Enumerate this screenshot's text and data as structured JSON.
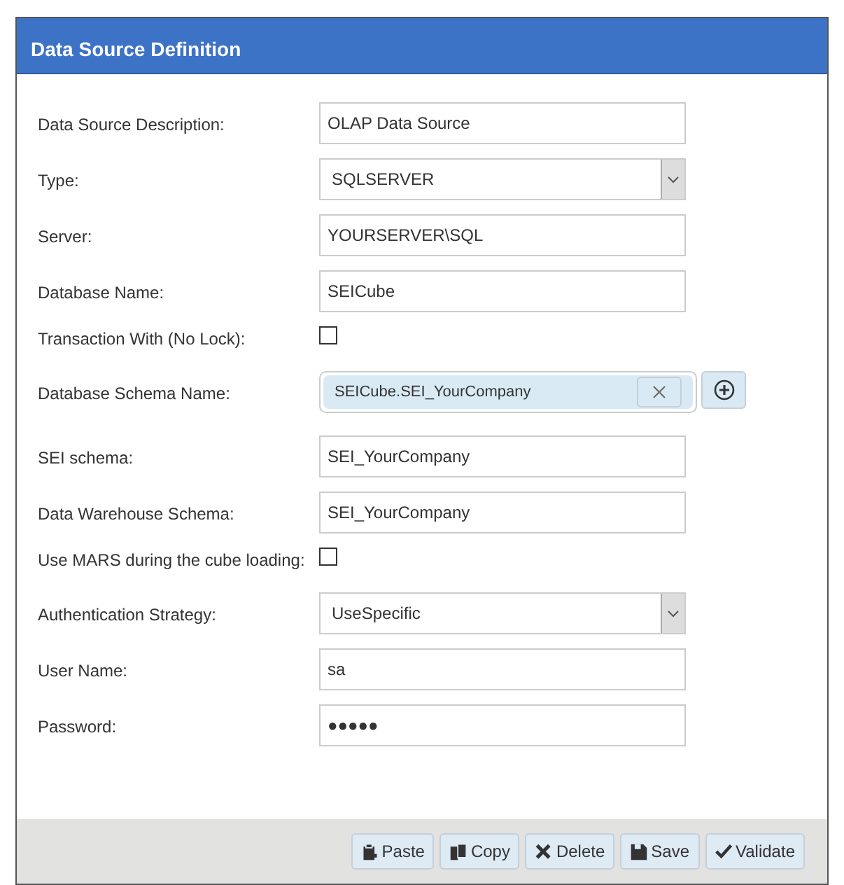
{
  "window": {
    "title": "Data Source Definition"
  },
  "fields": [
    {
      "kind": "text",
      "label": "Data Source Description:",
      "value": "OLAP Data Source"
    },
    {
      "kind": "select",
      "label": "Type:",
      "value": "SQLSERVER"
    },
    {
      "kind": "text",
      "label": "Server:",
      "value": "YOURSERVER\\SQL"
    },
    {
      "kind": "text",
      "label": "Database Name:",
      "value": "SEICube"
    },
    {
      "kind": "checkbox",
      "label": "Transaction With (No Lock):",
      "checked": false
    },
    {
      "kind": "tags",
      "label": "Database Schema Name:",
      "tags": [
        "SEICube.SEI_YourCompany"
      ]
    },
    {
      "kind": "text",
      "label": "SEI schema:",
      "value": "SEI_YourCompany"
    },
    {
      "kind": "text",
      "label": "Data Warehouse Schema:",
      "value": "SEI_YourCompany"
    },
    {
      "kind": "checkbox",
      "label": "Use MARS during the cube loading:",
      "checked": false
    },
    {
      "kind": "select",
      "label": "Authentication Strategy:",
      "value": "UseSpecific"
    },
    {
      "kind": "text",
      "label": "User Name:",
      "value": "sa"
    },
    {
      "kind": "text",
      "label": "Password:",
      "value": "●●●●●"
    }
  ],
  "buttons": [
    {
      "kind": "paste",
      "label": "Paste"
    },
    {
      "kind": "copy",
      "label": "Copy"
    },
    {
      "kind": "delete",
      "label": "Delete"
    },
    {
      "kind": "save",
      "label": "Save"
    },
    {
      "kind": "validate",
      "label": "Validate"
    }
  ]
}
